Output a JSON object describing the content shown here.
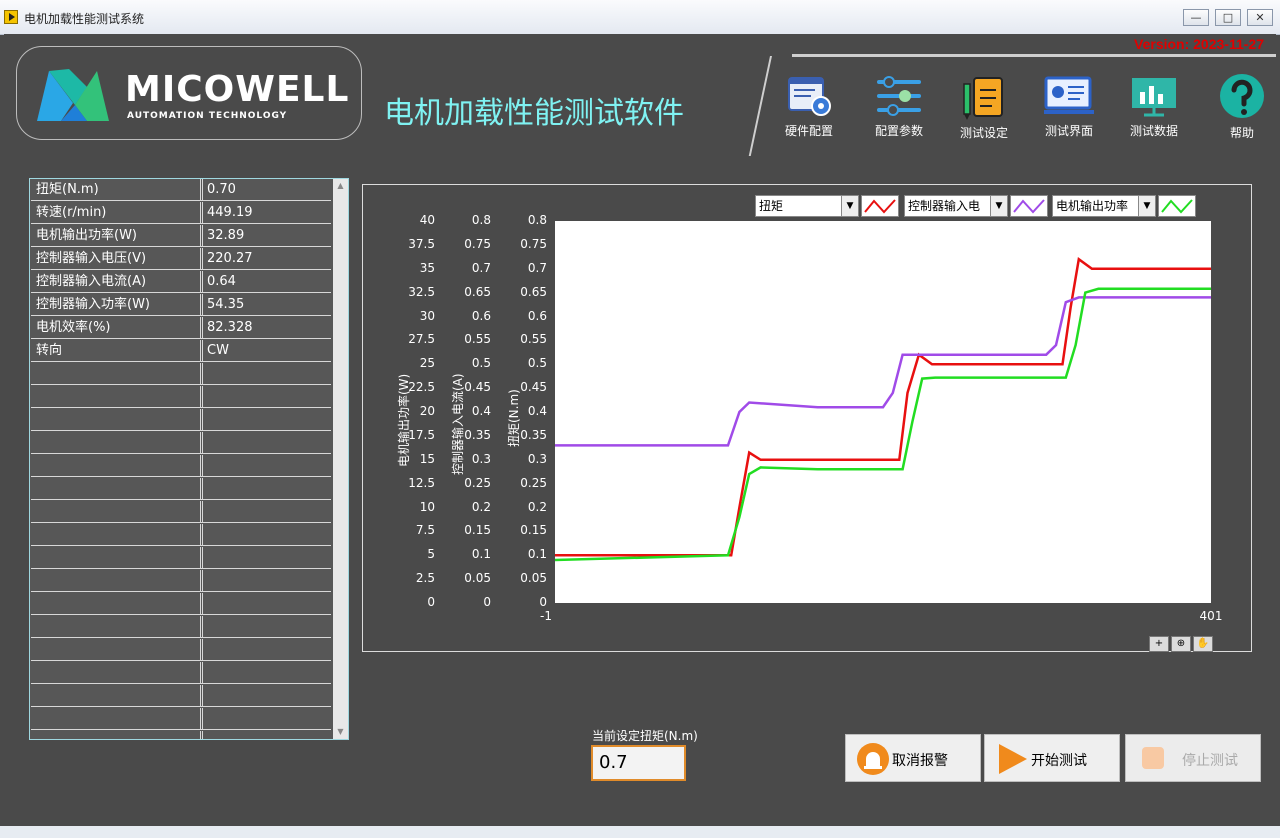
{
  "window": {
    "title": "电机加载性能测试系统",
    "min": "—",
    "max": "□",
    "close": "✕"
  },
  "version": "Version: 2023-11-27",
  "logo": {
    "name": "MICOWELL",
    "sub": "AUTOMATION TECHNOLOGY"
  },
  "app_title": "电机加载性能测试软件",
  "toolbar": [
    {
      "label": "硬件配置",
      "icon": "hardware-config-icon"
    },
    {
      "label": "配置参数",
      "icon": "config-params-icon"
    },
    {
      "label": "测试设定",
      "icon": "test-settings-icon"
    },
    {
      "label": "测试界面",
      "icon": "test-screen-icon"
    },
    {
      "label": "测试数据",
      "icon": "test-data-icon"
    },
    {
      "label": "帮助",
      "icon": "help-icon"
    }
  ],
  "table": {
    "rows": [
      {
        "name": "扭矩(N.m)",
        "value": "0.70"
      },
      {
        "name": "转速(r/min)",
        "value": "449.19"
      },
      {
        "name": "电机输出功率(W)",
        "value": "32.89"
      },
      {
        "name": "控制器输入电压(V)",
        "value": "220.27"
      },
      {
        "name": "控制器输入电流(A)",
        "value": "0.64"
      },
      {
        "name": "控制器输入功率(W)",
        "value": "54.35"
      },
      {
        "name": "电机效率(%)",
        "value": "82.328"
      },
      {
        "name": "转向",
        "value": "CW"
      }
    ],
    "empty_rows": 17
  },
  "legend": [
    {
      "label": "扭矩",
      "color": "#e81010"
    },
    {
      "label": "控制器输入电",
      "color": "#a04be8"
    },
    {
      "label": "电机输出功率",
      "color": "#22dd22"
    }
  ],
  "axes": {
    "power_label": "电机输出功率(W)",
    "current_label": "控制器输入电流(A)",
    "torque_label": "扭矩(N.m)",
    "power_ticks": [
      "40",
      "37.5",
      "35",
      "32.5",
      "30",
      "27.5",
      "25",
      "22.5",
      "20",
      "17.5",
      "15",
      "12.5",
      "10",
      "7.5",
      "5",
      "2.5",
      "0"
    ],
    "current_ticks": [
      "0.8",
      "0.75",
      "0.7",
      "0.65",
      "0.6",
      "0.55",
      "0.5",
      "0.45",
      "0.4",
      "0.35",
      "0.3",
      "0.25",
      "0.2",
      "0.15",
      "0.1",
      "0.05",
      "0"
    ],
    "torque_ticks": [
      "0.8",
      "0.75",
      "0.7",
      "0.65",
      "0.6",
      "0.55",
      "0.5",
      "0.45",
      "0.4",
      "0.35",
      "0.3",
      "0.25",
      "0.2",
      "0.15",
      "0.1",
      "0.05",
      "0"
    ],
    "x_min_label": "-1",
    "x_max_label": "401"
  },
  "chart_data": {
    "type": "line",
    "xlim": [
      -1,
      401
    ],
    "series": [
      {
        "name": "扭矩",
        "axis": "torque",
        "ylim": [
          0,
          0.8
        ],
        "x": [
          -1,
          107,
          112,
          118,
          125,
          160,
          210,
          215,
          222,
          230,
          310,
          315,
          320,
          328,
          401
        ],
        "values": [
          0.1,
          0.1,
          0.2,
          0.315,
          0.3,
          0.3,
          0.3,
          0.44,
          0.52,
          0.5,
          0.5,
          0.62,
          0.72,
          0.7,
          0.7
        ]
      },
      {
        "name": "控制器输入电",
        "axis": "current",
        "ylim": [
          0,
          0.8
        ],
        "x": [
          -1,
          100,
          105,
          112,
          118,
          160,
          200,
          206,
          212,
          220,
          300,
          306,
          312,
          320,
          401
        ],
        "values": [
          0.33,
          0.33,
          0.33,
          0.4,
          0.42,
          0.41,
          0.41,
          0.44,
          0.52,
          0.52,
          0.52,
          0.54,
          0.63,
          0.64,
          0.64
        ]
      },
      {
        "name": "电机输出功率",
        "axis": "power",
        "ylim": [
          0,
          40
        ],
        "x": [
          -1,
          105,
          112,
          118,
          125,
          160,
          212,
          218,
          224,
          232,
          312,
          318,
          324,
          332,
          401
        ],
        "values": [
          4.5,
          5.0,
          9,
          13.5,
          14.2,
          14.0,
          14.0,
          19,
          23.5,
          23.6,
          23.6,
          27,
          32.5,
          32.9,
          32.9
        ]
      }
    ]
  },
  "set_torque": {
    "label": "当前设定扭矩(N.m)",
    "value": "0.7"
  },
  "buttons": {
    "cancel_alarm": "取消报警",
    "start_test": "开始测试",
    "stop_test": "停止测试"
  }
}
